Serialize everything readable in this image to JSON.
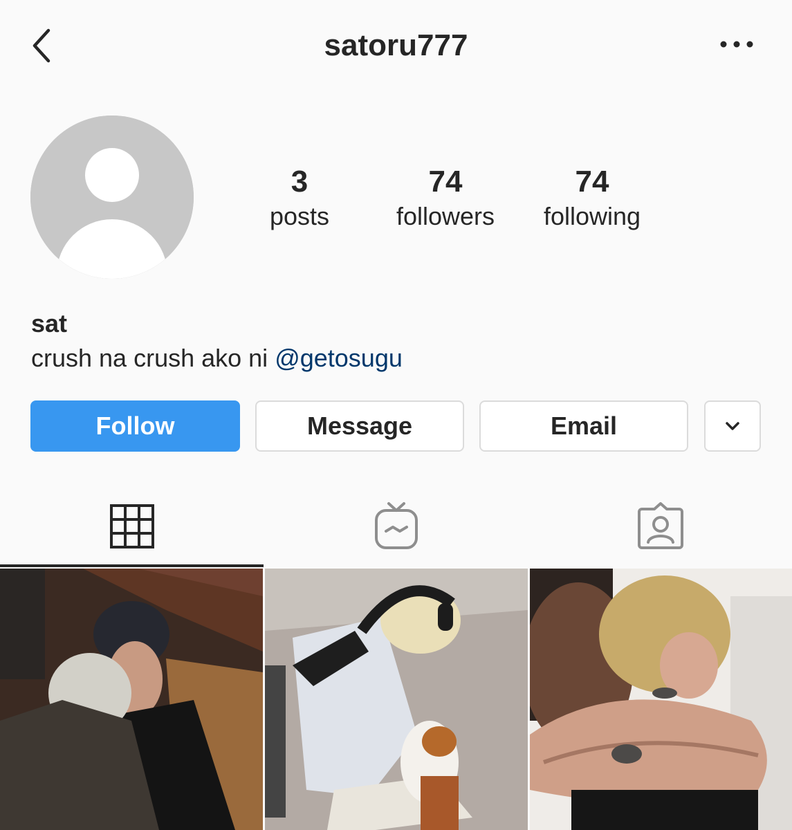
{
  "header": {
    "username": "satoru777",
    "back_icon": "chevron-left-icon",
    "more_icon": "more-horizontal-icon"
  },
  "profile": {
    "avatar_icon": "default-avatar-icon",
    "stats": {
      "posts_count": "3",
      "posts_label": "posts",
      "followers_count": "74",
      "followers_label": "followers",
      "following_count": "74",
      "following_label": "following"
    },
    "full_name": "sat",
    "bio_text": "crush na crush ako ni ",
    "bio_mention": "@getosugu"
  },
  "actions": {
    "follow_label": "Follow",
    "message_label": "Message",
    "email_label": "Email",
    "more_icon": "chevron-down-icon"
  },
  "tabs": [
    {
      "name": "grid",
      "icon": "grid-icon",
      "active": true
    },
    {
      "name": "igtv",
      "icon": "igtv-icon",
      "active": false
    },
    {
      "name": "tagged",
      "icon": "tagged-person-icon",
      "active": false
    }
  ],
  "colors": {
    "accent": "#3897f0",
    "mention": "#00376b",
    "text": "#262626",
    "border": "#dbdbdb",
    "background": "#fafafa"
  },
  "posts": [
    {
      "index": 1,
      "kind": "photo"
    },
    {
      "index": 2,
      "kind": "photo"
    },
    {
      "index": 3,
      "kind": "photo"
    }
  ]
}
